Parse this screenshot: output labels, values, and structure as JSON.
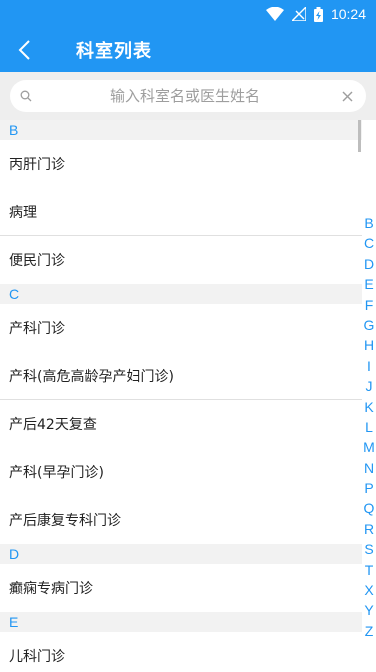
{
  "status_bar": {
    "time": "10:24"
  },
  "app_bar": {
    "title": "科室列表"
  },
  "search": {
    "placeholder": "输入科室名或医生姓名",
    "value": ""
  },
  "sections": [
    {
      "letter": "B",
      "items": [
        "丙肝门诊",
        "病理",
        "便民门诊"
      ]
    },
    {
      "letter": "C",
      "items": [
        "产科门诊",
        "产科(高危高龄孕产妇门诊)",
        "产后42天复查",
        "产科(早孕门诊)",
        "产后康复专科门诊"
      ]
    },
    {
      "letter": "D",
      "items": [
        "癫痫专病门诊"
      ]
    },
    {
      "letter": "E",
      "items": [
        "儿科门诊"
      ]
    }
  ],
  "index_letters": [
    "B",
    "C",
    "D",
    "E",
    "F",
    "G",
    "H",
    "I",
    "J",
    "K",
    "L",
    "M",
    "N",
    "P",
    "Q",
    "R",
    "S",
    "T",
    "X",
    "Y",
    "Z"
  ],
  "colors": {
    "primary": "#2196f3",
    "section_bg": "#f2f2f2",
    "search_bg": "#eeeeee"
  }
}
